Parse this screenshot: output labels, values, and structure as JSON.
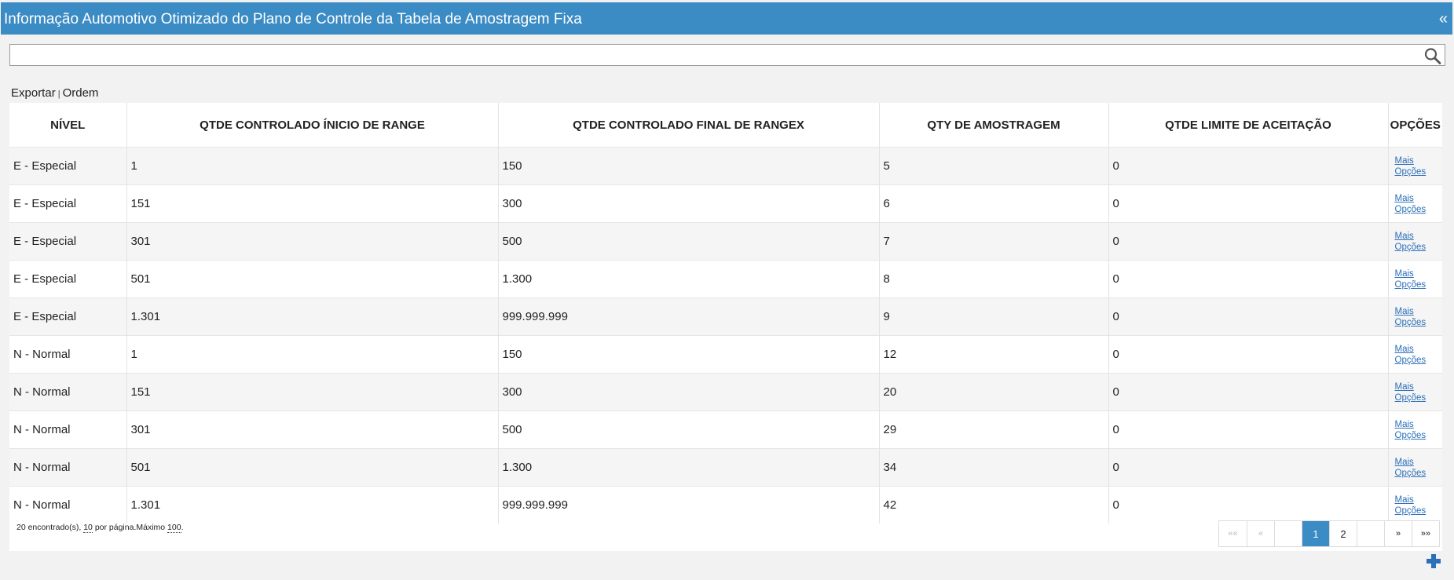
{
  "header": {
    "title": "Informação Automotivo Otimizado do Plano de Controle da Tabela de Amostragem Fixa",
    "collapse_icon": "«"
  },
  "search": {
    "value": "",
    "placeholder": ""
  },
  "actions": {
    "export_label": "Exportar",
    "separator": "|",
    "order_label": "Ordem"
  },
  "table": {
    "columns": [
      "NÍVEL",
      "QTDE CONTROLADO ÍNICIO DE RANGE",
      "QTDE CONTROLADO FINAL DE RANGEX",
      "QTY DE AMOSTRAGEM",
      "QTDE LIMITE DE ACEITAÇÃO",
      "OPÇÕES"
    ],
    "option_link_line1": "Mais",
    "option_link_line2": "Opções",
    "rows": [
      {
        "nivel": "E - Especial",
        "inicio": "1",
        "final": "150",
        "amostragem": "5",
        "limite": "0"
      },
      {
        "nivel": "E - Especial",
        "inicio": "151",
        "final": "300",
        "amostragem": "6",
        "limite": "0"
      },
      {
        "nivel": "E - Especial",
        "inicio": "301",
        "final": "500",
        "amostragem": "7",
        "limite": "0"
      },
      {
        "nivel": "E - Especial",
        "inicio": "501",
        "final": "1.300",
        "amostragem": "8",
        "limite": "0"
      },
      {
        "nivel": "E - Especial",
        "inicio": "1.301",
        "final": "999.999.999",
        "amostragem": "9",
        "limite": "0"
      },
      {
        "nivel": "N - Normal",
        "inicio": "1",
        "final": "150",
        "amostragem": "12",
        "limite": "0"
      },
      {
        "nivel": "N - Normal",
        "inicio": "151",
        "final": "300",
        "amostragem": "20",
        "limite": "0"
      },
      {
        "nivel": "N - Normal",
        "inicio": "301",
        "final": "500",
        "amostragem": "29",
        "limite": "0"
      },
      {
        "nivel": "N - Normal",
        "inicio": "501",
        "final": "1.300",
        "amostragem": "34",
        "limite": "0"
      },
      {
        "nivel": "N - Normal",
        "inicio": "1.301",
        "final": "999.999.999",
        "amostragem": "42",
        "limite": "0"
      }
    ]
  },
  "footer": {
    "found_text": "20 encontrado(s), ",
    "per_page_value": "10",
    "per_page_text": " por página.Máximo ",
    "max_value": "100",
    "max_suffix": "."
  },
  "pagination": {
    "first": "««",
    "prev": "«",
    "blank1": "",
    "pages": [
      "1",
      "2"
    ],
    "current_page": "1",
    "blank2": "",
    "next": "»",
    "last": "»»"
  },
  "colors": {
    "accent": "#3b8bc4",
    "link": "#2a6fb8"
  },
  "icons": {
    "search": "search-icon",
    "add": "plus-icon",
    "collapse": "double-chevron-left-icon"
  }
}
